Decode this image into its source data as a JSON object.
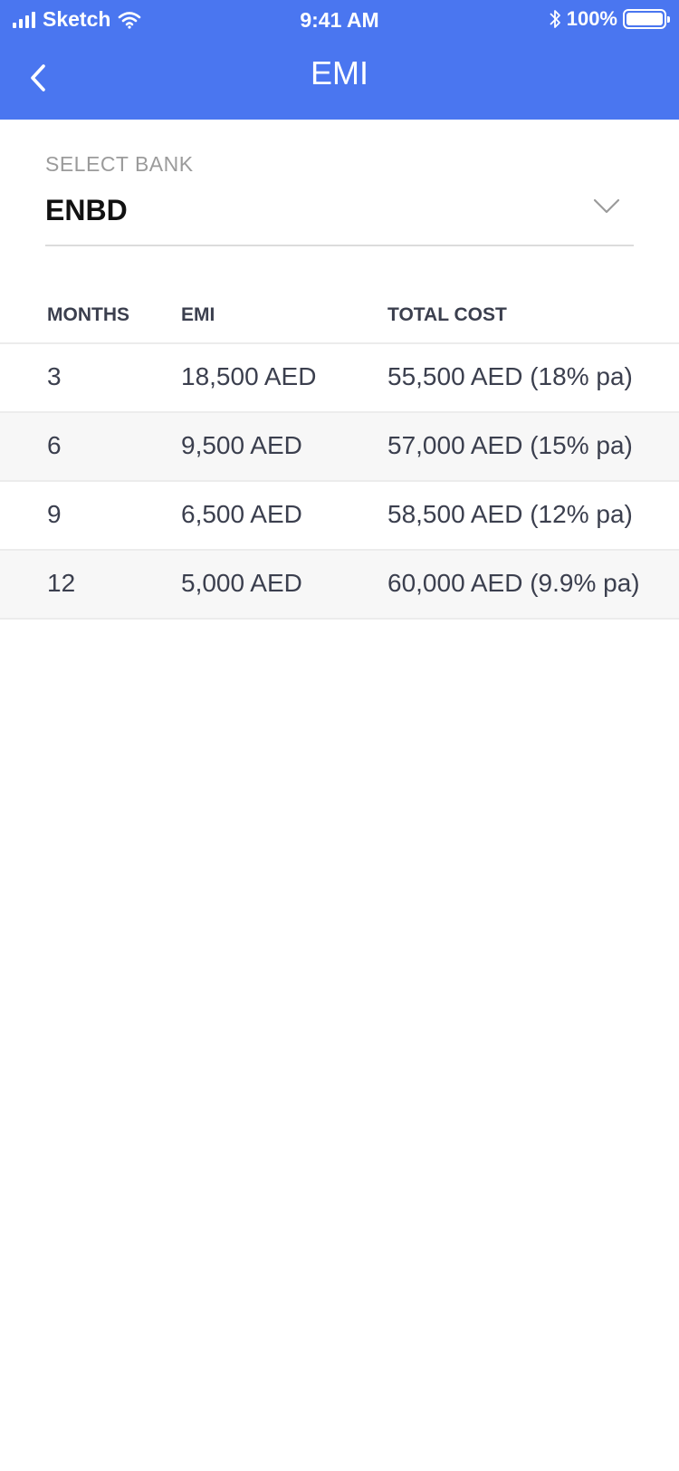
{
  "status_bar": {
    "carrier": "Sketch",
    "time": "9:41 AM",
    "battery": "100%"
  },
  "nav": {
    "title": "EMI",
    "back_icon": "chevron-left-icon"
  },
  "bank": {
    "label": "SELECT BANK",
    "value": "ENBD",
    "dropdown_icon": "chevron-down-icon"
  },
  "table": {
    "headers": [
      "MONTHS",
      "EMI",
      "TOTAL COST"
    ],
    "rows": [
      {
        "months": "3",
        "emi": "18,500 AED",
        "total": "55,500 AED (18% pa)"
      },
      {
        "months": "6",
        "emi": "9,500 AED",
        "total": "57,000 AED (15% pa)"
      },
      {
        "months": "9",
        "emi": "6,500 AED",
        "total": "58,500 AED (12% pa)"
      },
      {
        "months": "12",
        "emi": "5,000 AED",
        "total": "60,000 AED (9.9% pa)"
      }
    ]
  },
  "colors": {
    "header_bg": "#4a76f0",
    "text": "#3b3f4e",
    "muted": "#9b9b9b",
    "row_alt": "#f7f7f7"
  }
}
